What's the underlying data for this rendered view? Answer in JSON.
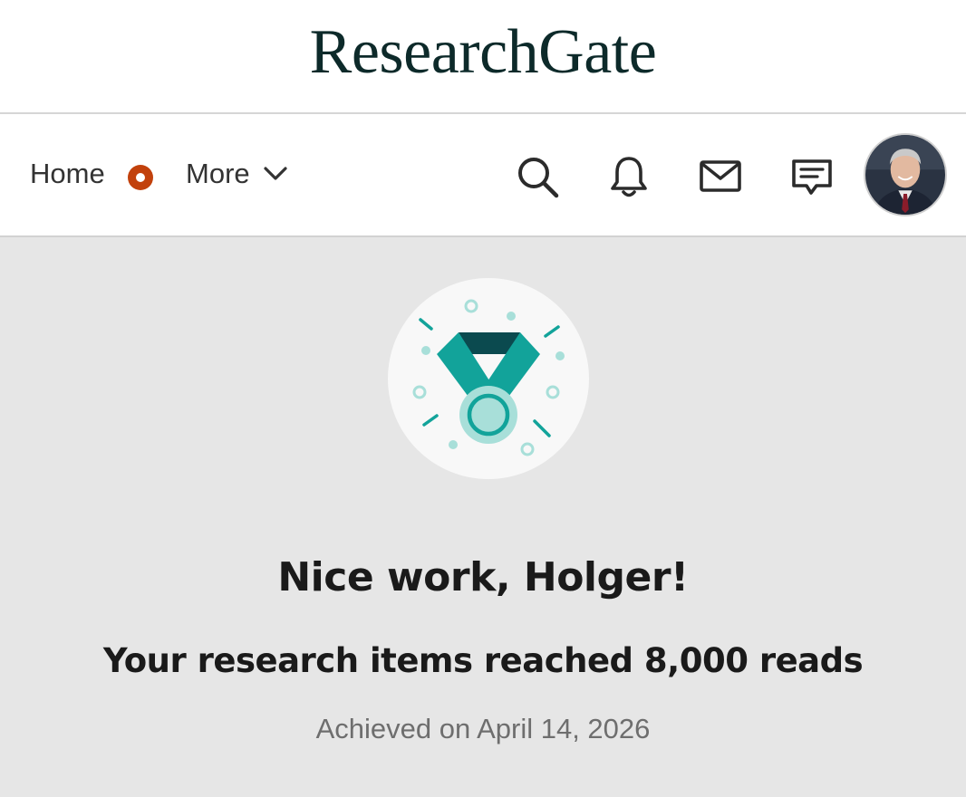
{
  "header": {
    "logo_text": "ResearchGate"
  },
  "nav": {
    "home_label": "Home",
    "more_label": "More",
    "icons": [
      "search-icon",
      "bell-icon",
      "mail-icon",
      "message-icon"
    ],
    "accent_color": "#c2410c"
  },
  "achievement": {
    "icon": "medal-icon",
    "headline": "Nice work, Holger!",
    "message": "Your research items reached 8,000 reads",
    "achieved_text": "Achieved on April 14, 2026",
    "colors": {
      "teal": "#12a39a",
      "dark_teal": "#0b4a4f",
      "light_teal": "#a8dfd9",
      "background": "#e6e6e6"
    }
  }
}
